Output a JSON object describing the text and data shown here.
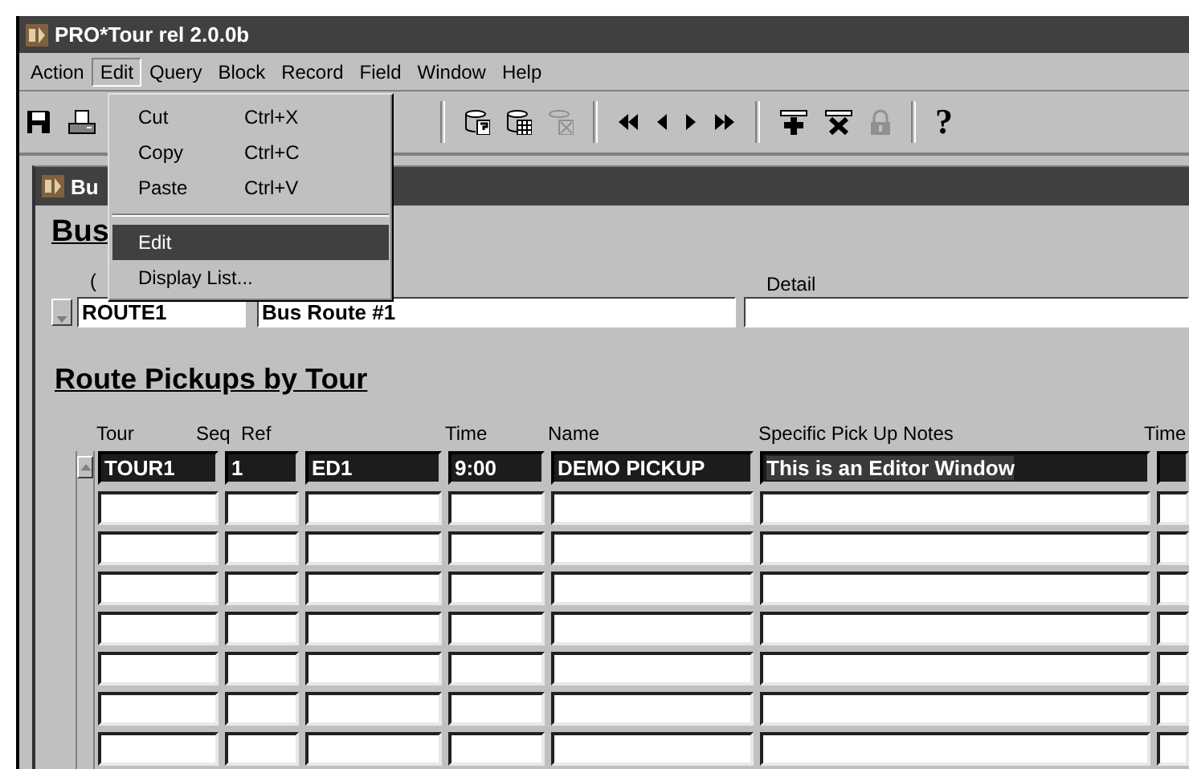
{
  "window": {
    "title": "PRO*Tour rel 2.0.0b"
  },
  "menubar": [
    {
      "label": "Action",
      "selected": false
    },
    {
      "label": "Edit",
      "selected": true
    },
    {
      "label": "Query",
      "selected": false
    },
    {
      "label": "Block",
      "selected": false
    },
    {
      "label": "Record",
      "selected": false
    },
    {
      "label": "Field",
      "selected": false
    },
    {
      "label": "Window",
      "selected": false
    },
    {
      "label": "Help",
      "selected": false
    }
  ],
  "open_menu": {
    "items": [
      {
        "kind": "item",
        "label": "Cut",
        "shortcut": "Ctrl+X",
        "selected": false
      },
      {
        "kind": "item",
        "label": "Copy",
        "shortcut": "Ctrl+C",
        "selected": false
      },
      {
        "kind": "item",
        "label": "Paste",
        "shortcut": "Ctrl+V",
        "selected": false
      },
      {
        "kind": "separator"
      },
      {
        "kind": "item",
        "label": "Edit",
        "selected": true
      },
      {
        "kind": "item",
        "label": "Display List...",
        "selected": false
      }
    ]
  },
  "toolbar": [
    {
      "kind": "save",
      "disabled": false
    },
    {
      "kind": "print",
      "disabled": false
    },
    {
      "kind": "separator"
    },
    {
      "kind": "query",
      "disabled": false
    },
    {
      "kind": "grid",
      "disabled": false
    },
    {
      "kind": "clear",
      "disabled": true
    },
    {
      "kind": "separator"
    },
    {
      "kind": "first",
      "disabled": false
    },
    {
      "kind": "prev",
      "disabled": false
    },
    {
      "kind": "next",
      "disabled": false
    },
    {
      "kind": "last",
      "disabled": false
    },
    {
      "kind": "separator"
    },
    {
      "kind": "insert",
      "disabled": false
    },
    {
      "kind": "remove",
      "disabled": false
    },
    {
      "kind": "lock",
      "disabled": true
    },
    {
      "kind": "separator"
    },
    {
      "kind": "help",
      "text": "?",
      "disabled": false
    }
  ],
  "inner_window": {
    "title": "Bu"
  },
  "form": {
    "heading": "Bus",
    "field_label": "(",
    "detail_label": "Detail",
    "code": "ROUTE1",
    "description": "Bus Route #1"
  },
  "pickups": {
    "heading": "Route Pickups by Tour",
    "columns": [
      "Tour",
      "Seq",
      "Ref",
      "Time",
      "Name",
      "Specific Pick Up Notes",
      "Time"
    ],
    "rows": [
      {
        "selected": true,
        "cells": [
          "TOUR1",
          "1",
          "ED1",
          "9:00",
          "DEMO PICKUP",
          "This is an Editor Window"
        ]
      },
      {
        "selected": false
      },
      {
        "selected": false
      },
      {
        "selected": false
      },
      {
        "selected": false
      },
      {
        "selected": false
      },
      {
        "selected": false
      },
      {
        "selected": false
      }
    ]
  }
}
